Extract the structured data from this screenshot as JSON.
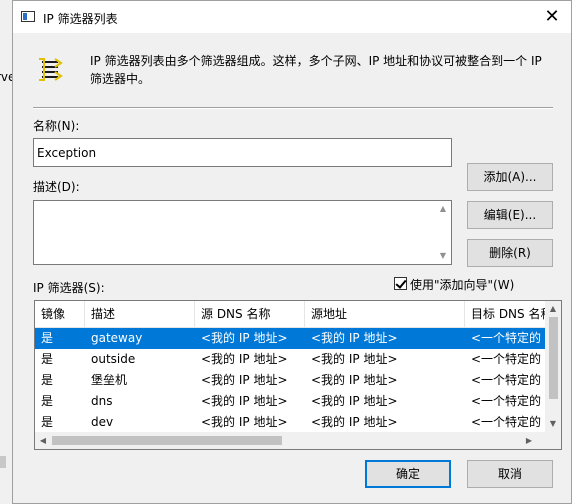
{
  "background_window": {
    "partial_text": "rve"
  },
  "dialog": {
    "title": "IP 筛选器列表",
    "close_glyph": "✕",
    "info_text": "IP 筛选器列表由多个筛选器组成。这样，多个子网、IP 地址和协议可被整合到一个 IP 筛选器中。",
    "name_label": "名称(N):",
    "name_value": "Exception",
    "desc_label": "描述(D):",
    "desc_value": "",
    "filters_label": "IP 筛选器(S):",
    "wizard_checkbox": {
      "label": "使用\"添加向导\"(W)",
      "checked": true
    },
    "buttons": {
      "add": "添加(A)...",
      "edit": "编辑(E)...",
      "remove": "删除(R)",
      "ok": "确定",
      "cancel": "取消"
    },
    "list": {
      "columns": [
        "镜像",
        "描述",
        "源 DNS 名称",
        "源地址",
        "目标 DNS 名称"
      ],
      "rows": [
        {
          "mirror": "是",
          "description": "gateway",
          "src_dns": "<我的 IP 地址>",
          "src_addr": "<我的 IP 地址>",
          "dst_dns": "<一个特定的 IP 地址>",
          "selected": true
        },
        {
          "mirror": "是",
          "description": "outside",
          "src_dns": "<我的 IP 地址>",
          "src_addr": "<我的 IP 地址>",
          "dst_dns": "<一个特定的 IP 地址>",
          "selected": false
        },
        {
          "mirror": "是",
          "description": "堡垒机",
          "src_dns": "<我的 IP 地址>",
          "src_addr": "<我的 IP 地址>",
          "dst_dns": "<一个特定的 IP 地址>",
          "selected": false
        },
        {
          "mirror": "是",
          "description": "dns",
          "src_dns": "<我的 IP 地址>",
          "src_addr": "<我的 IP 地址>",
          "dst_dns": "<一个特定的 IP 地址>",
          "selected": false
        },
        {
          "mirror": "是",
          "description": "dev",
          "src_dns": "<我的 IP 地址>",
          "src_addr": "<我的 IP 地址>",
          "dst_dns": "<一个特定的 IP 地址>",
          "selected": false
        }
      ]
    },
    "icons": {
      "title": "ip-filter-list-window-icon",
      "info": "filter-list-icon"
    },
    "colors": {
      "selection": "#0078d7",
      "default_button_border": "#0078d7"
    }
  }
}
